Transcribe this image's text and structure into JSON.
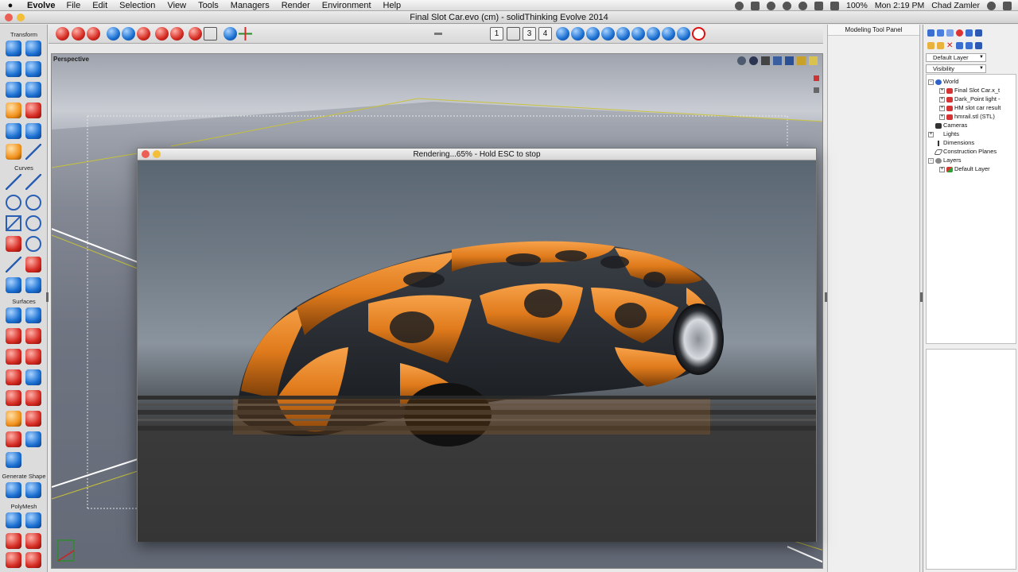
{
  "menubar": {
    "apple": "",
    "app_name": "Evolve",
    "menus": [
      "File",
      "Edit",
      "Selection",
      "View",
      "Tools",
      "Managers",
      "Render",
      "Environment",
      "Help"
    ],
    "battery": "100%",
    "clock": "Mon 2:19 PM",
    "user": "Chad Zamler"
  },
  "window": {
    "title": "Final Slot Car.evo (cm) - solidThinking Evolve 2014"
  },
  "toolbox": {
    "sections": [
      "Transform",
      "Curves",
      "Surfaces",
      "Generate Shape",
      "PolyMesh"
    ]
  },
  "toolbar": {
    "view_numbers": [
      "1",
      "3",
      "4"
    ]
  },
  "viewport": {
    "label": "Perspective"
  },
  "render_window": {
    "status": "Rendering...65% - Hold ESC to stop",
    "progress_percent": 65
  },
  "modeling_panel": {
    "title": "Modeling Tool Panel"
  },
  "browser": {
    "layer_dropdown": "Default Layer",
    "visibility_dropdown": "Visibility",
    "tree": [
      {
        "label": "World",
        "level": 0,
        "toggle": "-",
        "icon": "world"
      },
      {
        "label": "Final Slot Car.x_t",
        "level": 2,
        "toggle": "+",
        "icon": "object"
      },
      {
        "label": "Dark_Point light -",
        "level": 2,
        "toggle": "+",
        "icon": "object"
      },
      {
        "label": "HM slot car result",
        "level": 2,
        "toggle": "+",
        "icon": "object"
      },
      {
        "label": "hmrail.stl (STL)",
        "level": 2,
        "toggle": "+",
        "icon": "object"
      },
      {
        "label": "Cameras",
        "level": 0,
        "toggle": "",
        "icon": "camera"
      },
      {
        "label": "Lights",
        "level": 0,
        "toggle": "+",
        "icon": "light"
      },
      {
        "label": "Dimensions",
        "level": 0,
        "toggle": "",
        "icon": "dimension"
      },
      {
        "label": "Construction Planes",
        "level": 0,
        "toggle": "",
        "icon": "plane"
      },
      {
        "label": "Layers",
        "level": 0,
        "toggle": "-",
        "icon": "layers"
      },
      {
        "label": "Default Layer",
        "level": 2,
        "toggle": "+",
        "icon": "layer"
      }
    ]
  }
}
